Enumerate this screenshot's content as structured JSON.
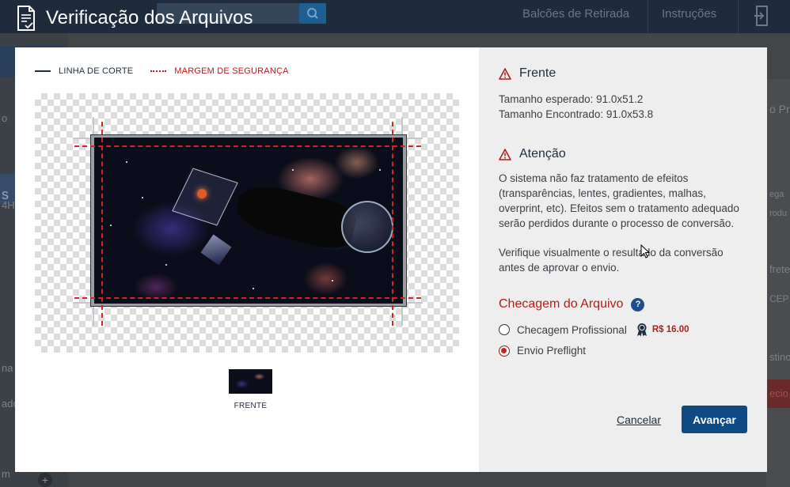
{
  "header": {
    "title": "Verificação dos Arquivos",
    "nav": [
      "Balcões de Retirada",
      "Instruções"
    ]
  },
  "background": {
    "left_fragments": [
      "o",
      "s",
      "4H",
      "na",
      "ado",
      "m"
    ],
    "right_fragments": [
      "o Pr",
      "ega",
      "rodu",
      "frete",
      "CEP",
      "stinc",
      "ecio"
    ]
  },
  "legend": {
    "cut_label": "LINHA DE CORTE",
    "safety_label": "MARGEM DE SEGURANÇA"
  },
  "preview": {
    "thumbnail_label": "FRENTE"
  },
  "front": {
    "heading": "Frente",
    "expected": "Tamanho esperado: 91.0x51.2",
    "found": "Tamanho Encontrado: 91.0x53.8"
  },
  "attention": {
    "heading": "Atenção",
    "paragraph1": "O sistema não faz tratamento de efeitos (transparências, lentes, gradientes, malhas, overprint, etc). Efeitos sem o tratamento adequado serão perdidos durante o processo de conversão.",
    "paragraph2": "Verifique visualmente o resultado da conversão antes de aprovar o envio."
  },
  "check": {
    "heading": "Checagem do Arquivo",
    "help": "?",
    "options": [
      {
        "label": "Checagem Profissional",
        "price": "R$ 16.00",
        "selected": false
      },
      {
        "label": "Envio Preflight",
        "selected": true
      }
    ]
  },
  "actions": {
    "cancel": "Cancelar",
    "next": "Avançar"
  },
  "colors": {
    "accent_red": "#b41d1d",
    "primary_blue": "#0f4a85",
    "dark_text": "#1f2d3d"
  }
}
